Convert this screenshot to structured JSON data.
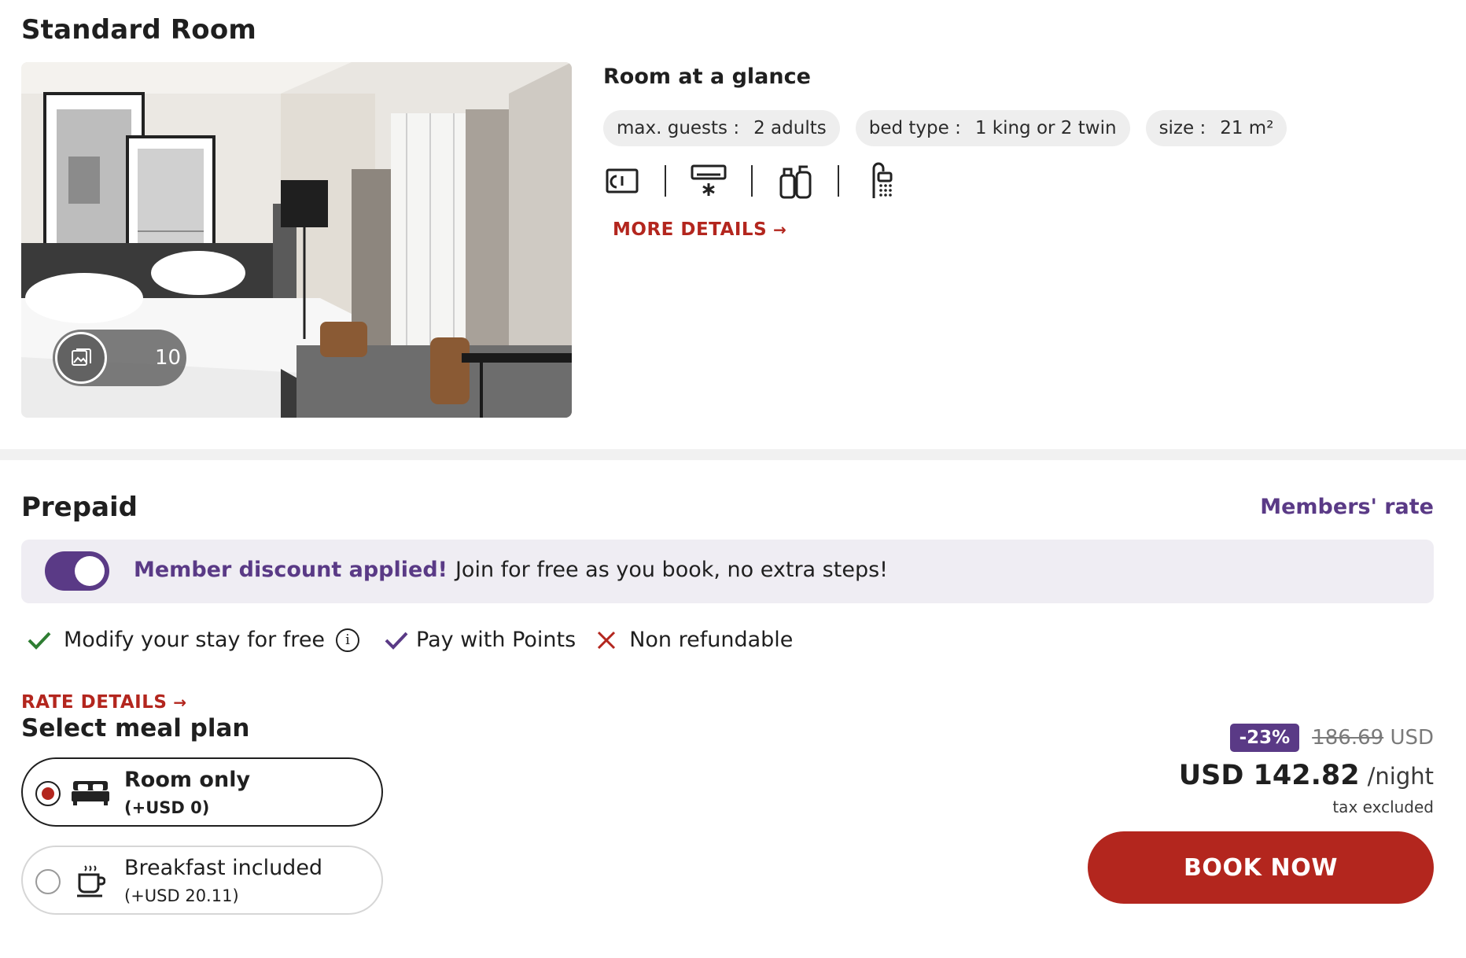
{
  "room": {
    "title": "Standard Room",
    "gallery_count": "10",
    "glance_title": "Room at a glance",
    "chips": [
      {
        "label": "max. guests :",
        "value": "2 adults"
      },
      {
        "label": "bed type :",
        "value": "1 king or 2 twin"
      },
      {
        "label": "size :",
        "value": "21 m²"
      }
    ],
    "amenities": [
      "safe-icon",
      "air-conditioning-icon",
      "toiletries-icon",
      "shower-icon"
    ],
    "more_details": "MORE DETAILS"
  },
  "rate": {
    "title": "Prepaid",
    "members_rate": "Members' rate",
    "banner": {
      "strong": "Member discount applied!",
      "text": "Join for free as you book, no extra steps!",
      "toggle_on": true
    },
    "features": [
      {
        "icon": "check-icon",
        "text": "Modify your stay for free",
        "color": "#2e7d32",
        "has_info": true
      },
      {
        "icon": "check-icon",
        "text": "Pay with Points",
        "color": "#5a3a86",
        "has_info": false
      },
      {
        "icon": "cross-icon",
        "text": "Non refundable",
        "color": "#b3261e",
        "has_info": false
      }
    ],
    "rate_details": "RATE DETAILS"
  },
  "meal": {
    "title": "Select meal plan",
    "options": [
      {
        "name": "Room only",
        "price": "(+USD 0)",
        "icon": "bed-icon",
        "selected": true
      },
      {
        "name": "Breakfast included",
        "price": "(+USD 20.11)",
        "icon": "coffee-cup-icon",
        "selected": false
      }
    ]
  },
  "price": {
    "discount": "-23%",
    "old_price": "186.69",
    "old_currency": "USD",
    "current": "USD 142.82",
    "per_night": "/night",
    "tax": "tax excluded",
    "book": "BOOK NOW"
  },
  "colors": {
    "brand_red": "#b3261e",
    "member_purple": "#5a3a86",
    "banner_bg": "#efedf3",
    "check_green": "#2e7d32"
  }
}
